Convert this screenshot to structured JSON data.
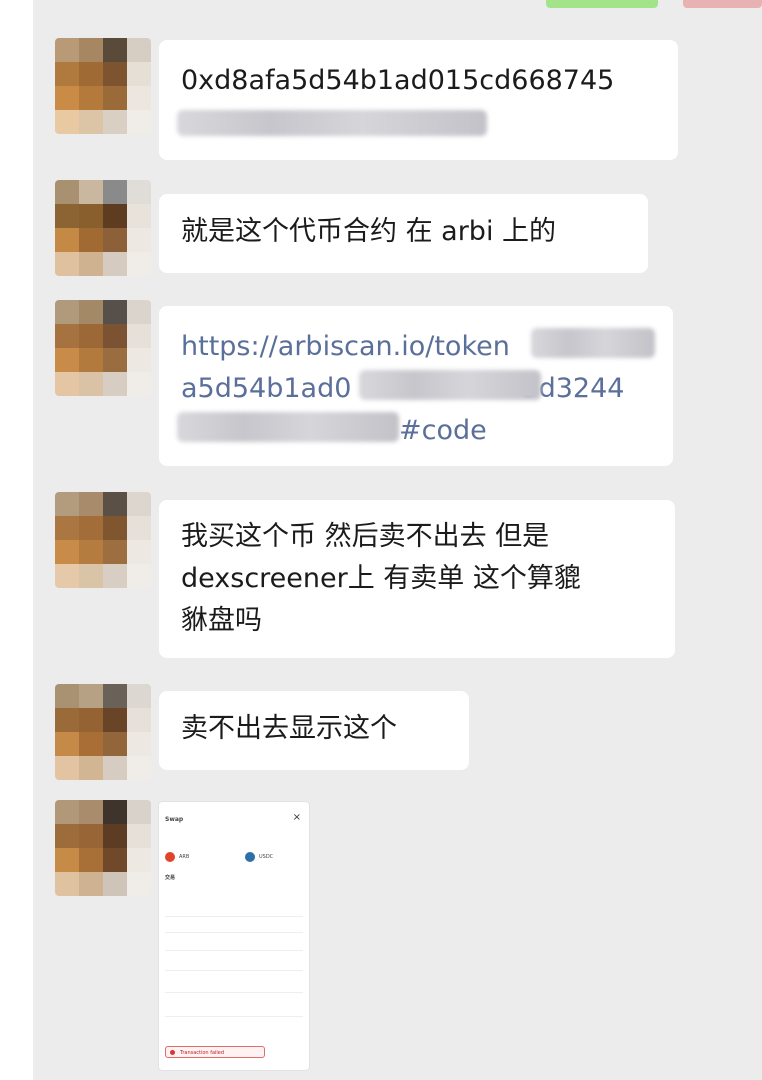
{
  "messages": [
    {
      "lines": [
        "0xd8afa5d54b1ad015cd668745"
      ],
      "has_redacted_line": true
    },
    {
      "lines": [
        "就是这个代币合约 在 arbi 上的"
      ]
    },
    {
      "link_lines": [
        "https://arbiscan.io/token",
        "a5d54b1ad0",
        "5d3244",
        "#code"
      ]
    },
    {
      "lines": [
        "我买这个币 然后卖不出去 但是",
        "dexscreener上 有卖单 这个算貔",
        "貅盘吗"
      ]
    },
    {
      "lines": [
        "卖不出去显示这个"
      ]
    }
  ],
  "screenshot": {
    "title": "Swap",
    "close": "×",
    "section": "交易",
    "token_from": "ARB",
    "token_to": "USDC",
    "alert": "Transaction failed"
  },
  "colors": {
    "chat_bg": "#ececec",
    "bubble_bg": "#ffffff",
    "link": "#5a6f99",
    "send_button": "#a3e48b"
  }
}
